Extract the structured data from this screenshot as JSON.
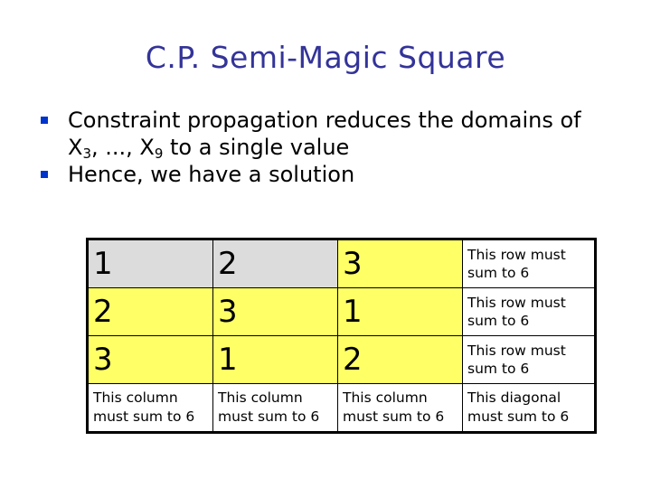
{
  "slide": {
    "title": "C.P. Semi-Magic Square",
    "bullets": [
      {
        "line1": "Constraint propagation reduces the domains of",
        "line2_prefix": "X",
        "line2_sub1": "3",
        "line2_mid": ", ..., X",
        "line2_sub2": "9",
        "line2_suffix": " to a single value"
      },
      {
        "text": "Hence, we have a solution"
      }
    ],
    "colors": {
      "title": "#333399",
      "bullet_marker": "#0033cc",
      "assigned_cell": "#dcdcdc",
      "propagated_cell": "#ffff66"
    }
  },
  "grid": {
    "rows": [
      {
        "cells": [
          "1",
          "2",
          "3"
        ],
        "note": [
          "This row must",
          "sum to 6"
        ]
      },
      {
        "cells": [
          "2",
          "3",
          "1"
        ],
        "note": [
          "This row must",
          "sum to 6"
        ]
      },
      {
        "cells": [
          "3",
          "1",
          "2"
        ],
        "note": [
          "This row must",
          "sum to 6"
        ]
      }
    ],
    "column_notes": [
      [
        "This column",
        "must sum to 6"
      ],
      [
        "This column",
        "must sum to 6"
      ],
      [
        "This column",
        "must sum to 6"
      ]
    ],
    "diagonal_note": [
      "This diagonal",
      "must sum to 6"
    ]
  }
}
